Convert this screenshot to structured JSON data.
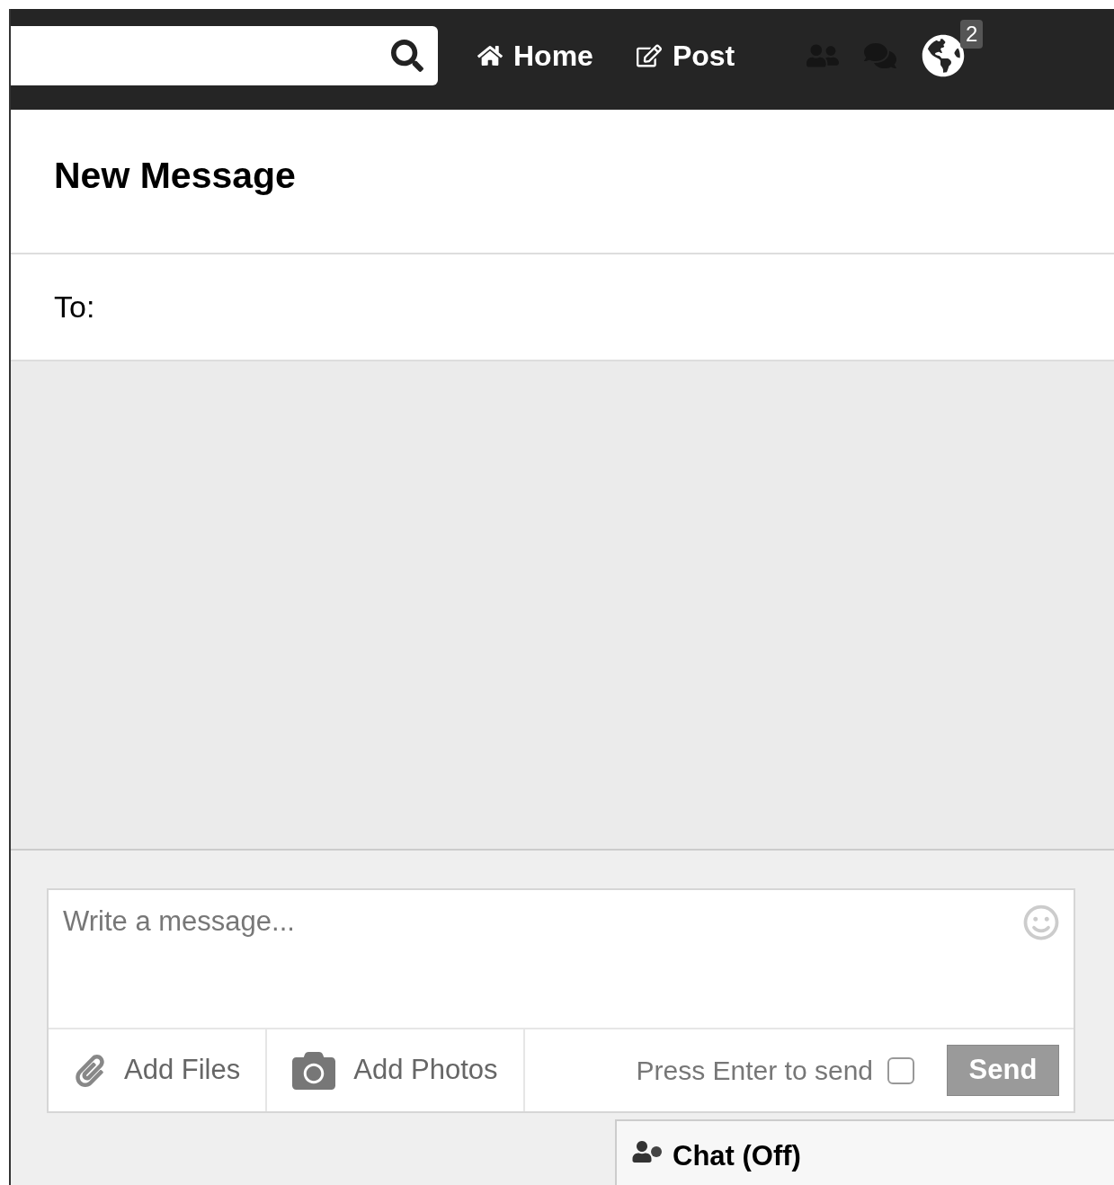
{
  "top_bar": {
    "nav": [
      {
        "kind": "home",
        "label": "Home"
      },
      {
        "kind": "post",
        "label": "Post"
      }
    ],
    "icons": [
      {
        "kind": "friends"
      },
      {
        "kind": "messages"
      },
      {
        "kind": "globe",
        "badge": "2"
      }
    ]
  },
  "title": "New Message",
  "to_label": "To:",
  "composer": {
    "placeholder": "Write a message...",
    "attachments": [
      {
        "kind": "files",
        "label": "Add Files"
      },
      {
        "kind": "photos",
        "label": "Add Photos"
      }
    ],
    "enter_to_send": {
      "label": "Press Enter to send",
      "checked": false
    },
    "send": {
      "label": "Send",
      "disabled": true
    }
  },
  "chat": {
    "label": "Chat (Off)"
  }
}
